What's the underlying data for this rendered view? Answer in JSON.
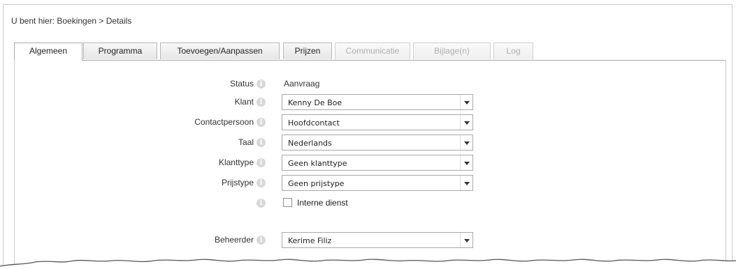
{
  "breadcrumb": "U bent hier: Boekingen > Details",
  "tabs": [
    {
      "label": "Algemeen",
      "state": "active"
    },
    {
      "label": "Programma",
      "state": "normal"
    },
    {
      "label": "Toevoegen/Aanpassen",
      "state": "normal"
    },
    {
      "label": "Prijzen",
      "state": "normal"
    },
    {
      "label": "Communicatie",
      "state": "disabled"
    },
    {
      "label": "Bijlage(n)",
      "state": "disabled"
    },
    {
      "label": "Log",
      "state": "disabled"
    }
  ],
  "form": {
    "status": {
      "label": "Status",
      "value": "Aanvraag"
    },
    "klant": {
      "label": "Klant",
      "value": "Kenny De Boe"
    },
    "contactpersoon": {
      "label": "Contactpersoon",
      "value": "Hoofdcontact"
    },
    "taal": {
      "label": "Taal",
      "value": "Nederlands"
    },
    "klanttype": {
      "label": "Klanttype",
      "value": "Geen klanttype"
    },
    "prijstype": {
      "label": "Prijstype",
      "value": "Geen prijstype"
    },
    "interne_dienst": {
      "label": "Interne dienst",
      "checked": false
    },
    "beheerder": {
      "label": "Beheerder",
      "value": "Kerime Filiz"
    }
  },
  "info_icon": "i"
}
